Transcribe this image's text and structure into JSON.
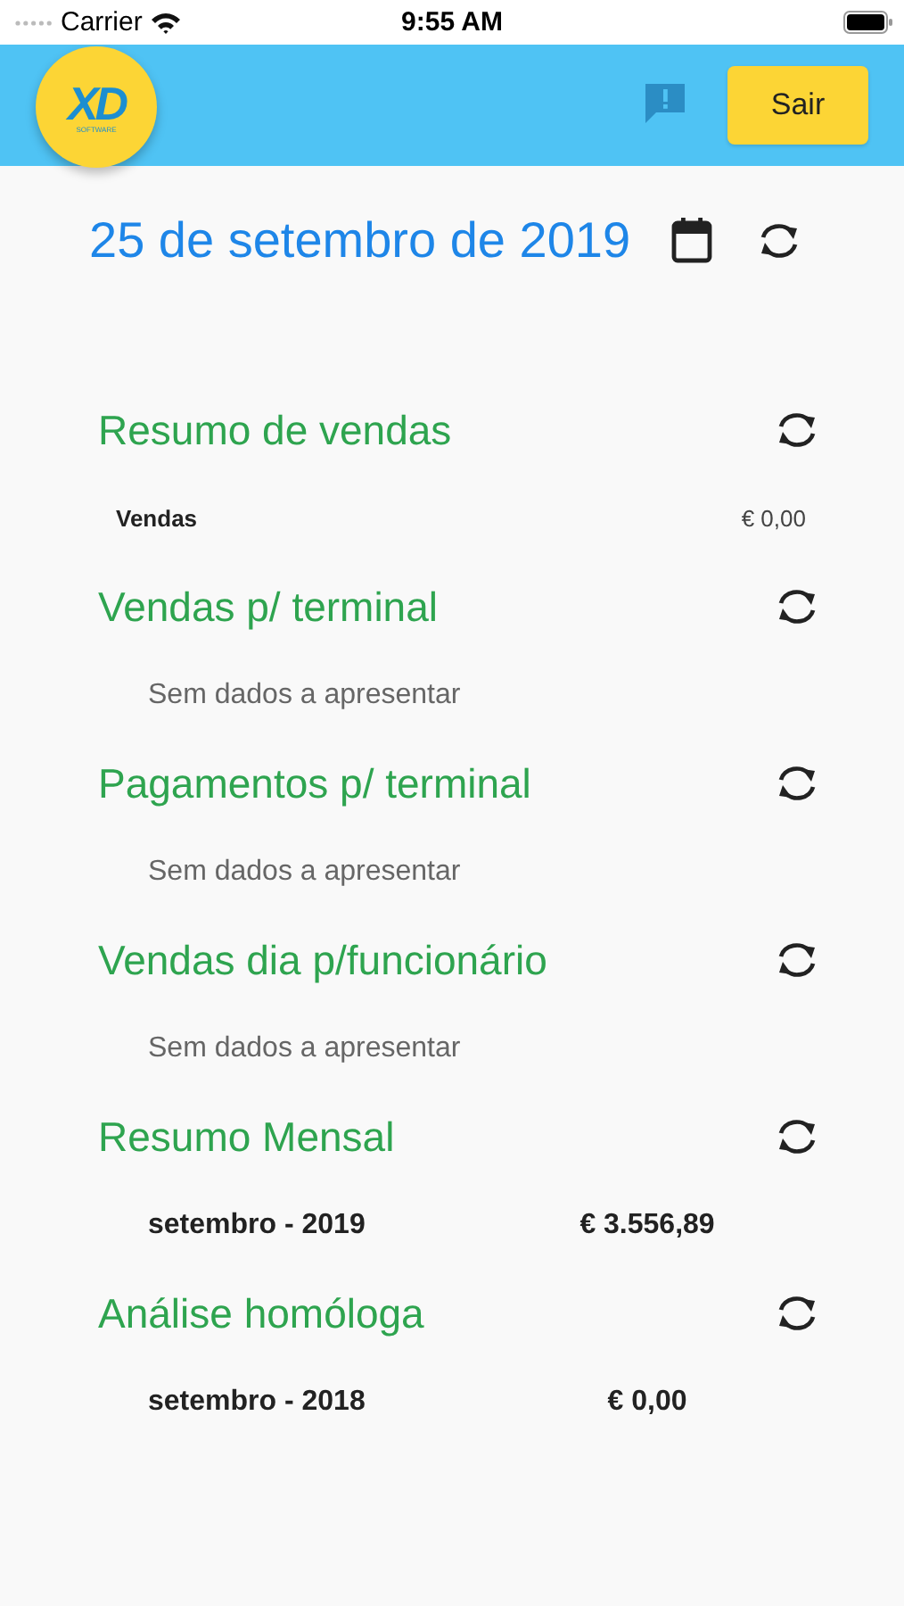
{
  "status_bar": {
    "carrier": "Carrier",
    "time": "9:55 AM"
  },
  "header": {
    "logo": {
      "text": "XD",
      "subtext": "SOFTWARE"
    },
    "logout_button": "Sair"
  },
  "date": "25 de setembro de 2019",
  "sections": [
    {
      "title": "Resumo de vendas",
      "kind": "summary",
      "rows": [
        {
          "label": "Vendas",
          "value": "€ 0,00"
        }
      ]
    },
    {
      "title": "Vendas p/ terminal",
      "kind": "empty",
      "message": "Sem dados a apresentar"
    },
    {
      "title": "Pagamentos p/ terminal",
      "kind": "empty",
      "message": "Sem dados a apresentar"
    },
    {
      "title": "Vendas dia p/funcionário",
      "kind": "empty",
      "message": "Sem dados a apresentar"
    },
    {
      "title": "Resumo Mensal",
      "kind": "period",
      "rows": [
        {
          "label": "setembro - 2019",
          "value": "€ 3.556,89"
        }
      ]
    },
    {
      "title": "Análise homóloga",
      "kind": "period",
      "rows": [
        {
          "label": "setembro - 2018",
          "value": "€ 0,00"
        }
      ]
    }
  ]
}
